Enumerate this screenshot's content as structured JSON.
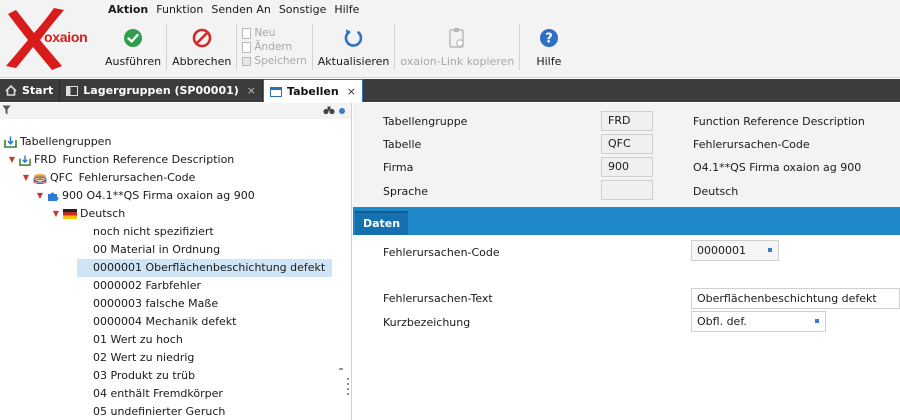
{
  "logo": {
    "text": "oxaion"
  },
  "menu": [
    "Aktion",
    "Funktion",
    "Senden An",
    "Sonstige",
    "Hilfe"
  ],
  "toolbar": {
    "execute": "Ausführen",
    "cancel": "Abbrechen",
    "new": "Neu",
    "change": "Ändern",
    "save": "Speichern",
    "refresh": "Aktualisieren",
    "copy_link": "oxaion-Link kopieren",
    "help": "Hilfe"
  },
  "tabs": {
    "home": "Start",
    "tab1": "Lagergruppen (SP00001)",
    "tab2": "Tabellen",
    "close": "×"
  },
  "tree": {
    "root": "Tabellengruppen",
    "n1_code": "FRD",
    "n1_text": "Function Reference Description",
    "n2_code": "QFC",
    "n2_text": "Fehlerursachen-Code",
    "n3": "900 O4.1**QS Firma oxaion ag 900",
    "n4": "Deutsch",
    "items": [
      "noch nicht spezifiziert",
      "00  Material in Ordnung",
      "0000001  Oberflächenbeschichtung defekt",
      "0000002  Farbfehler",
      "0000003  falsche Maße",
      "0000004  Mechanik defekt",
      "01  Wert zu hoch",
      "02  Wert zu niedrig",
      "03  Produkt zu trüb",
      "04  enthält Fremdkörper",
      "05  undefinierter Geruch"
    ]
  },
  "header": {
    "tabellengruppe_label": "Tabellengruppe",
    "tabellengruppe_value": "FRD",
    "tabellengruppe_desc": "Function Reference Description",
    "tabelle_label": "Tabelle",
    "tabelle_value": "QFC",
    "tabelle_desc": "Fehlerursachen-Code",
    "firma_label": "Firma",
    "firma_value": "900",
    "firma_desc": "O4.1**QS Firma oxaion ag 900",
    "sprache_label": "Sprache",
    "sprache_value": "",
    "sprache_desc": "Deutsch"
  },
  "section": {
    "title": "Daten"
  },
  "form": {
    "code_label": "Fehlerursachen-Code",
    "code_value": "0000001",
    "text_label": "Fehlerursachen-Text",
    "text_value": "Oberflächenbeschichtung defekt",
    "short_label": "Kurzbezeichung",
    "short_value": "Obfl. def."
  },
  "colors": {
    "accent": "#1e88c8",
    "tabbar": "#3c3c3c",
    "brand_red": "#d81b1b",
    "selection": "#cfe5f6"
  },
  "icons": {
    "execute": "check-circle-icon",
    "cancel": "no-entry-icon",
    "refresh": "refresh-icon",
    "copy_link": "clipboard-link-icon",
    "help": "help-circle-icon"
  }
}
